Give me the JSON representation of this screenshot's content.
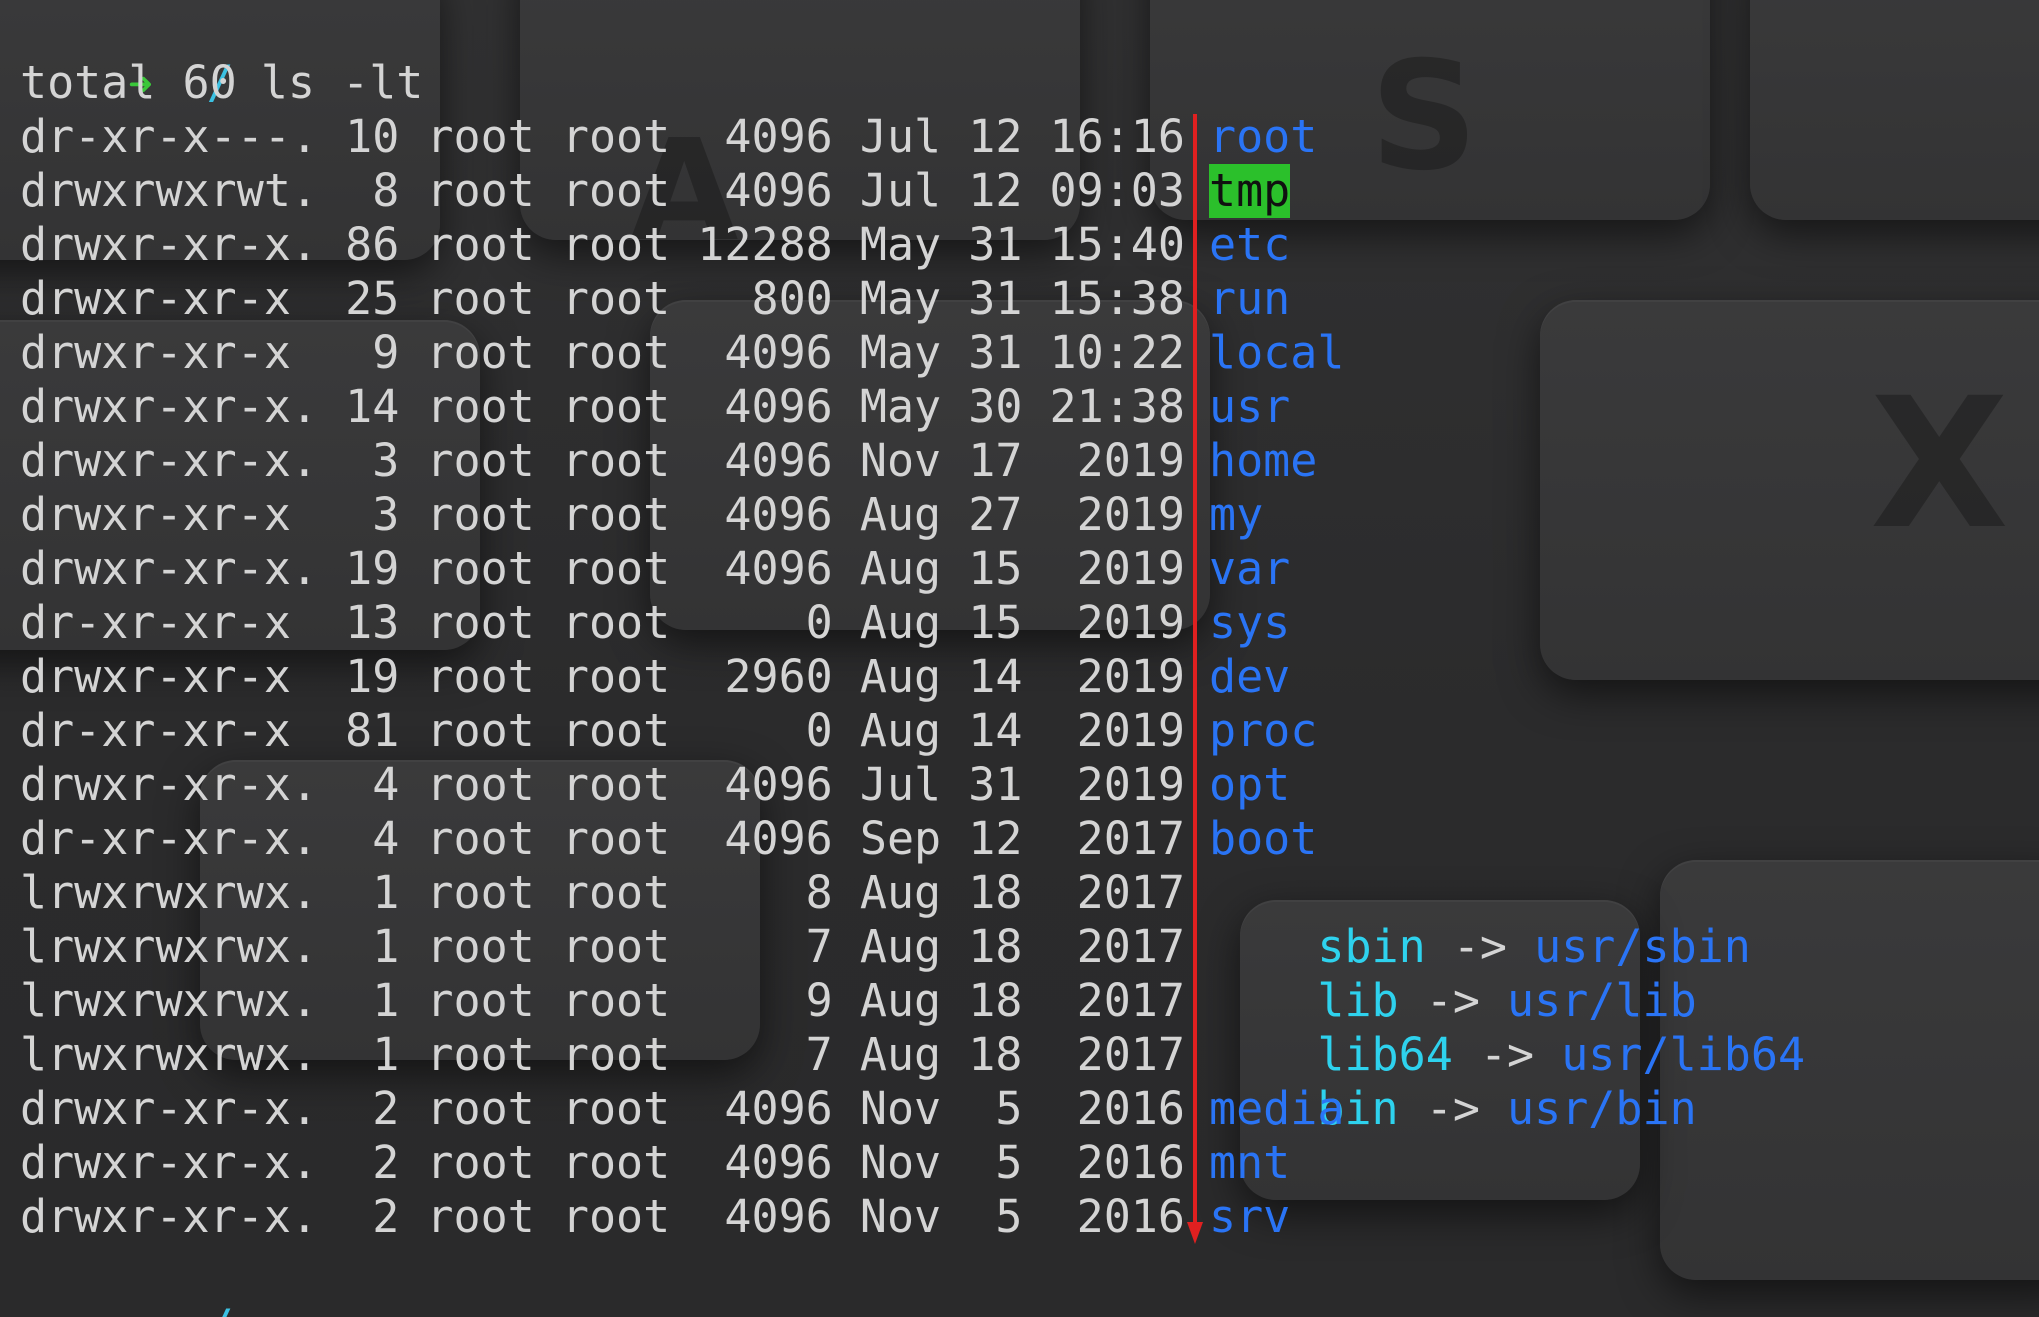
{
  "prompt": {
    "arrow": "➜",
    "dir": "/",
    "command": "ls -lt"
  },
  "total": "total 60",
  "entries": [
    {
      "meta": "dr-xr-x---. 10 root root  4096 Jul 12 16:16",
      "name": "root"
    },
    {
      "meta": "drwxrwxrwt.  8 root root  4096 Jul 12 09:03",
      "name": "tmp"
    },
    {
      "meta": "drwxr-xr-x. 86 root root 12288 May 31 15:40",
      "name": "etc"
    },
    {
      "meta": "drwxr-xr-x  25 root root   800 May 31 15:38",
      "name": "run"
    },
    {
      "meta": "drwxr-xr-x   9 root root  4096 May 31 10:22",
      "name": "local"
    },
    {
      "meta": "drwxr-xr-x. 14 root root  4096 May 30 21:38",
      "name": "usr"
    },
    {
      "meta": "drwxr-xr-x.  3 root root  4096 Nov 17  2019",
      "name": "home"
    },
    {
      "meta": "drwxr-xr-x   3 root root  4096 Aug 27  2019",
      "name": "my"
    },
    {
      "meta": "drwxr-xr-x. 19 root root  4096 Aug 15  2019",
      "name": "var"
    },
    {
      "meta": "dr-xr-xr-x  13 root root     0 Aug 15  2019",
      "name": "sys"
    },
    {
      "meta": "drwxr-xr-x  19 root root  2960 Aug 14  2019",
      "name": "dev"
    },
    {
      "meta": "dr-xr-xr-x  81 root root     0 Aug 14  2019",
      "name": "proc"
    },
    {
      "meta": "drwxr-xr-x.  4 root root  4096 Jul 31  2019",
      "name": "opt"
    },
    {
      "meta": "dr-xr-xr-x.  4 root root  4096 Sep 12  2017",
      "name": "boot"
    },
    {
      "meta": "lrwxrwxrwx.  1 root root     8 Aug 18  2017",
      "name": "sbin",
      "arrow": "->",
      "target": "usr/sbin"
    },
    {
      "meta": "lrwxrwxrwx.  1 root root     7 Aug 18  2017",
      "name": "lib",
      "arrow": "->",
      "target": "usr/lib"
    },
    {
      "meta": "lrwxrwxrwx.  1 root root     9 Aug 18  2017",
      "name": "lib64",
      "arrow": "->",
      "target": "usr/lib64"
    },
    {
      "meta": "lrwxrwxrwx.  1 root root     7 Aug 18  2017",
      "name": "bin",
      "arrow": "->",
      "target": "usr/bin"
    },
    {
      "meta": "drwxr-xr-x.  2 root root  4096 Nov  5  2016",
      "name": "media"
    },
    {
      "meta": "drwxr-xr-x.  2 root root  4096 Nov  5  2016",
      "name": "mnt"
    },
    {
      "meta": "drwxr-xr-x.  2 root root  4096 Nov  5  2016",
      "name": "srv"
    }
  ],
  "colors": {
    "background": "#2c2c2d",
    "text": "#d4d4d4",
    "directory": "#2a74f5",
    "symlink": "#2ed2ee",
    "sticky_highlight_bg": "#2bc02b",
    "prompt_arrow": "#3ac73a",
    "prompt_dir": "#3bc1e3",
    "annotation_arrow": "#e02020"
  },
  "icons": {
    "prompt": "arrow-right-icon",
    "annotation": "red-down-arrow-icon"
  },
  "highlighted_entry": "tmp"
}
